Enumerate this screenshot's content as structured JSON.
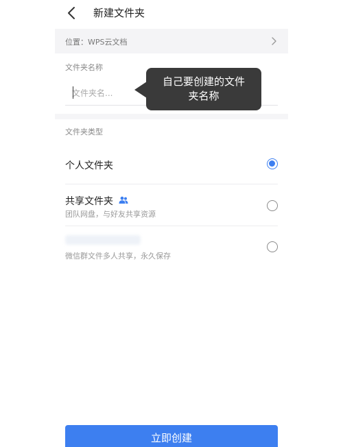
{
  "header": {
    "title": "新建文件夹",
    "back_icon": "chevron-left-icon"
  },
  "location": {
    "text": "位置：WPS云文档",
    "chevron_icon": "chevron-right-icon"
  },
  "name_section": {
    "label": "文件夹名称",
    "placeholder": "文件夹名..."
  },
  "tooltip": {
    "line1": "自己要创建的文件",
    "line2": "夹名称"
  },
  "type_section": {
    "label": "文件夹类型",
    "options": [
      {
        "title": "个人文件夹",
        "subtitle": "",
        "selected": true
      },
      {
        "title": "共享文件夹",
        "subtitle": "团队网盘，与好友共享资源",
        "selected": false,
        "icon": "group-icon"
      },
      {
        "title": "",
        "subtitle": "微信群文件多人共享，永久保存",
        "selected": false
      }
    ]
  },
  "create_button": {
    "label": "立即创建"
  },
  "colors": {
    "accent": "#3d7ff0",
    "tooltip_bg": "#3a3a3a"
  }
}
